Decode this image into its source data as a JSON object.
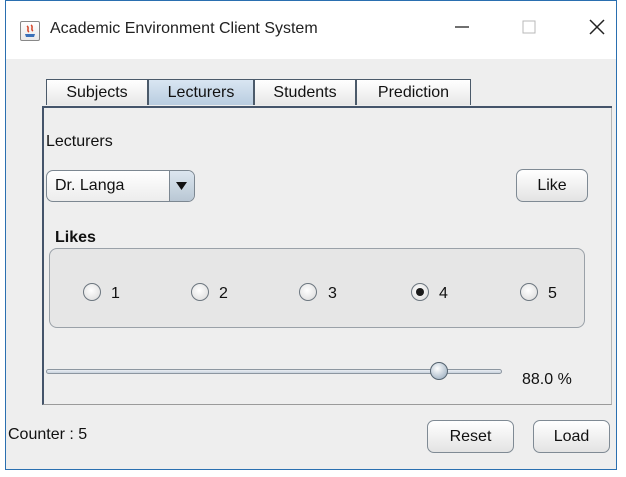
{
  "window": {
    "title": "Academic Environment Client System",
    "minimize_icon": "minimize-icon",
    "maximize_icon": "maximize-icon",
    "close_icon": "close-icon"
  },
  "tabs": [
    {
      "label": "Subjects",
      "selected": false
    },
    {
      "label": "Lecturers",
      "selected": true
    },
    {
      "label": "Students",
      "selected": false
    },
    {
      "label": "Prediction",
      "selected": false
    }
  ],
  "panel": {
    "section_label": "Lecturers",
    "lecturer_select": {
      "selected": "Dr. Langa"
    },
    "like_button": "Like",
    "likes_group": {
      "title": "Likes",
      "options": [
        "1",
        "2",
        "3",
        "4",
        "5"
      ],
      "selected": "4"
    },
    "slider": {
      "value_percent": 88.0,
      "label": "88.0 %"
    }
  },
  "footer": {
    "counter_text": "Counter : 5",
    "reset_button": "Reset",
    "load_button": "Load"
  },
  "colors": {
    "selected_tab": "#b9cde0",
    "window_border": "#2a6fb0",
    "panel_bg": "#eeeeee"
  }
}
